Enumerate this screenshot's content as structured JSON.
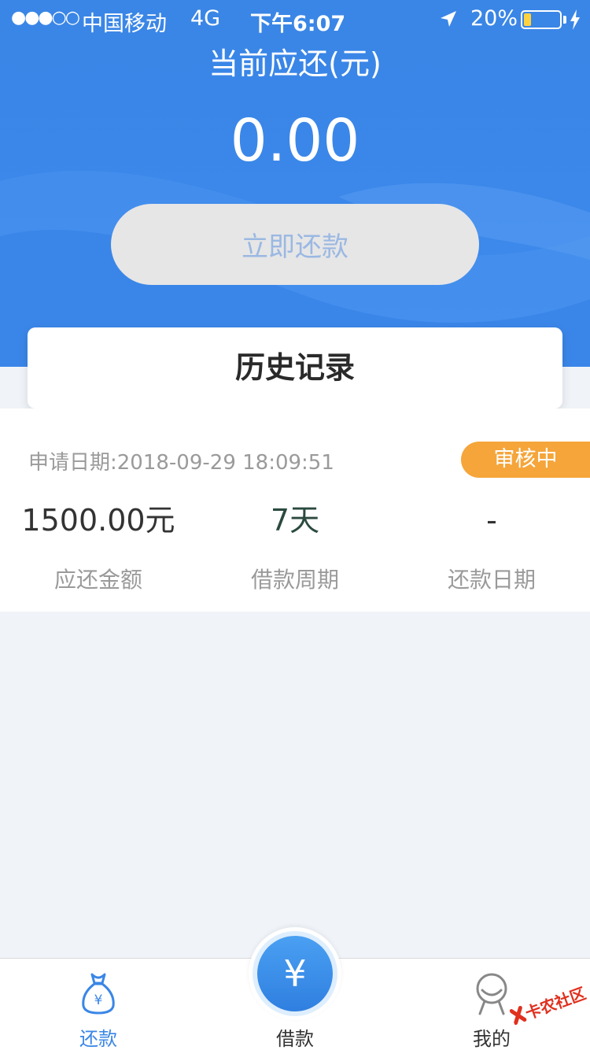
{
  "status_bar": {
    "signal": "●●●○○",
    "carrier": "中国移动",
    "network": "4G",
    "time": "下午6:07",
    "battery_pct": "20%",
    "battery_level": 0.2
  },
  "header": {
    "title": "当前应还(元)",
    "amount": "0.00",
    "repay_button": "立即还款"
  },
  "history": {
    "title": "历史记录"
  },
  "record": {
    "apply_date": "申请日期:2018-09-29 18:09:51",
    "status": "审核中",
    "amount_value": "1500.00元",
    "amount_label": "应还金额",
    "period_value": "7天",
    "period_label": "借款周期",
    "repay_date_value": "-",
    "repay_date_label": "还款日期"
  },
  "tabbar": {
    "tabs": [
      {
        "label": "还款",
        "icon": "money-bag-icon",
        "active": true
      },
      {
        "label": "借款",
        "icon": "yuan-icon",
        "active": false
      },
      {
        "label": "我的",
        "icon": "user-icon",
        "active": false
      }
    ],
    "center_symbol": "¥",
    "bag_symbol": "¥"
  },
  "watermark": {
    "text": "卡农社区"
  },
  "colors": {
    "header_blue": "#3a86e6",
    "badge_orange": "#f5a53a",
    "active_tab": "#3a86e6"
  }
}
